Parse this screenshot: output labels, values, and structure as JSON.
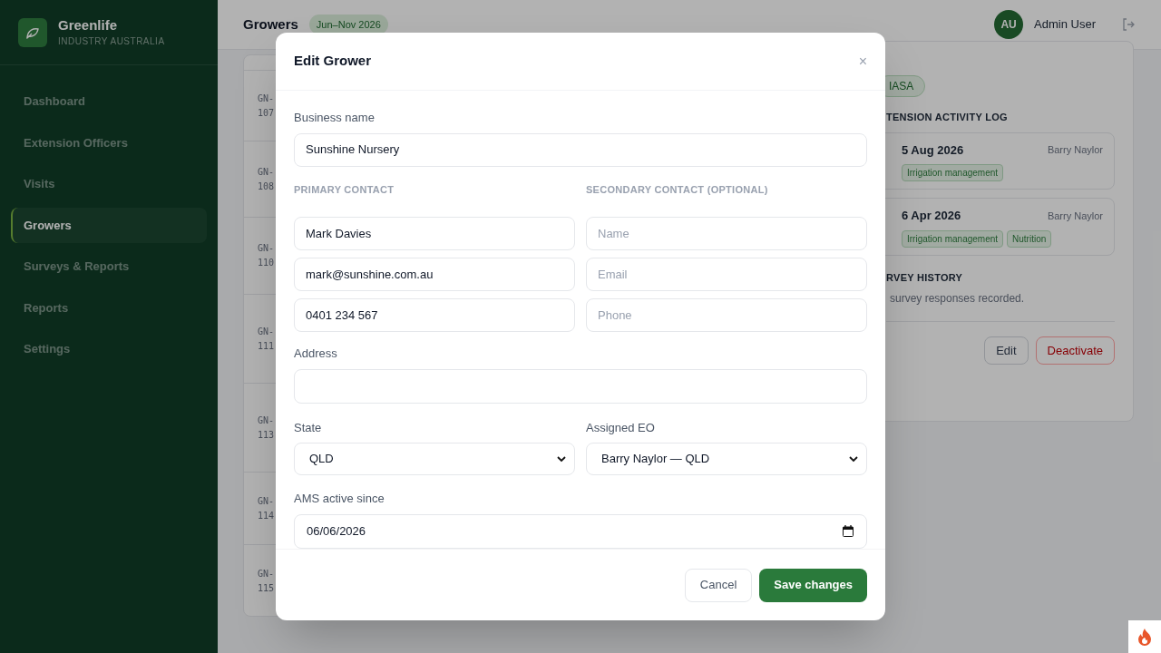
{
  "sidebar": {
    "brand": {
      "name": "Greenlife",
      "tagline": "INDUSTRY AUSTRALIA"
    },
    "items": [
      {
        "label": "Dashboard",
        "selected": false
      },
      {
        "label": "Extension Officers",
        "selected": false
      },
      {
        "label": "Visits",
        "selected": false
      },
      {
        "label": "Growers",
        "selected": true
      },
      {
        "label": "Surveys & Reports",
        "selected": false
      },
      {
        "label": "Reports",
        "selected": false
      },
      {
        "label": "Settings",
        "selected": false
      }
    ]
  },
  "header": {
    "title": "Growers",
    "period": "Jun–Nov 2026",
    "user": {
      "initials": "AU",
      "name": "Admin User"
    }
  },
  "grower_list": {
    "rows": [
      {
        "prefix": "GN-",
        "number": "107"
      },
      {
        "prefix": "GN-",
        "number": "108"
      },
      {
        "prefix": "GN-",
        "number": "110"
      },
      {
        "prefix": "GN-",
        "number": "111"
      },
      {
        "prefix": "GN-",
        "number": "113"
      },
      {
        "prefix": "GN-",
        "number": "114"
      },
      {
        "prefix": "GN-",
        "number": "115"
      }
    ]
  },
  "grower_detail": {
    "accreditation": "IASA",
    "activity_heading": "TENSION ACTIVITY LOG",
    "activity_log": [
      {
        "date": "5 Aug 2026",
        "officer": "Barry Naylor",
        "tags": [
          "Irrigation management"
        ]
      },
      {
        "date": "6 Apr 2026",
        "officer": "Barry Naylor",
        "tags": [
          "Irrigation management",
          "Nutrition"
        ]
      }
    ],
    "survey_heading": "RVEY HISTORY",
    "survey_empty": "survey responses recorded.",
    "buttons": [
      {
        "label": "Edit",
        "kind": "neutral"
      },
      {
        "label": "Deactivate",
        "kind": "danger"
      }
    ]
  },
  "dialog": {
    "title": "Edit Grower",
    "close": "×",
    "business_name": {
      "label": "Business name",
      "value": "Sunshine Nursery"
    },
    "primary_contact": {
      "heading": "PRIMARY CONTACT",
      "fields": [
        {
          "value": "Mark Davies"
        },
        {
          "value": "mark@sunshine.com.au"
        },
        {
          "value": "0401 234 567"
        }
      ]
    },
    "secondary_contact": {
      "heading": "SECONDARY CONTACT (OPTIONAL)",
      "fields": [
        {
          "placeholder": "Name"
        },
        {
          "placeholder": "Email"
        },
        {
          "placeholder": "Phone"
        }
      ]
    },
    "address": {
      "label": "Address"
    },
    "state": {
      "label": "State",
      "value": "QLD"
    },
    "assigned_eo": {
      "label": "Assigned EO",
      "value": "Barry Naylor — QLD"
    },
    "ams_active_since": {
      "label": "AMS active since",
      "value": "06/06/2026"
    },
    "buttons": [
      {
        "label": "Cancel",
        "kind": "secondary"
      },
      {
        "label": "Save changes",
        "kind": "primary"
      }
    ]
  }
}
